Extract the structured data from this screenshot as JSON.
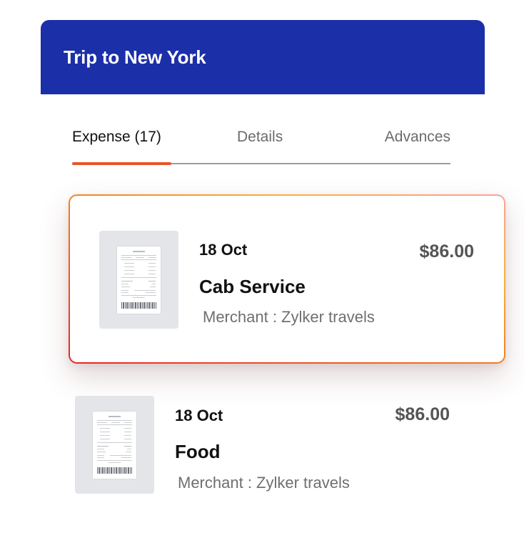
{
  "header": {
    "title": "Trip to New York",
    "color": "#1b2fa8"
  },
  "tabs": [
    {
      "label": "Expense (17)",
      "active": true
    },
    {
      "label": "Details",
      "active": false
    },
    {
      "label": "Advances",
      "active": false
    }
  ],
  "accent_color": "#e8552b",
  "expenses": [
    {
      "date": "18 Oct",
      "title": "Cab Service",
      "merchant": "Merchant : Zylker travels",
      "amount": "$86.00",
      "selected": true,
      "thumbnail_icon": "receipt-icon"
    },
    {
      "date": "18 Oct",
      "title": "Food",
      "merchant": "Merchant : Zylker travels",
      "amount": "$86.00",
      "selected": false,
      "thumbnail_icon": "receipt-icon"
    }
  ]
}
